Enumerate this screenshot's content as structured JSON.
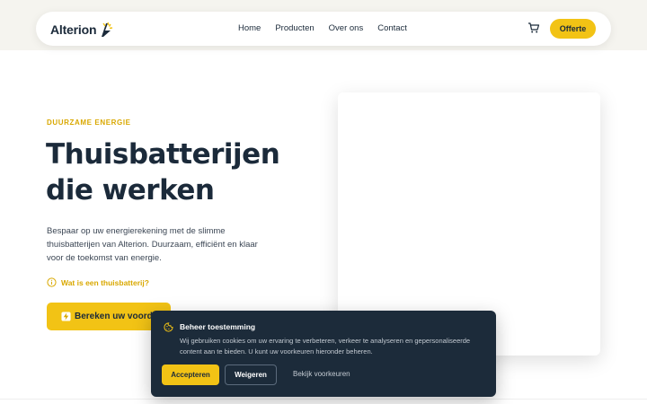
{
  "header": {
    "logo_text": "Alterion",
    "nav": [
      "Home",
      "Producten",
      "Over ons",
      "Contact"
    ],
    "cta_label": "Offerte"
  },
  "hero": {
    "eyebrow": "DUURZAME ENERGIE",
    "title": "Thuisbatterijen die werken",
    "lead": "Bespaar op uw energierekening met de slimme thuisbatterijen van Alterion. Duurzaam, efficiënt en klaar voor de toekomst van energie.",
    "link_label": "Wat is een thuisbatterij?",
    "button_label": "Bereken uw voordeel"
  },
  "cookie": {
    "title": "Beheer toestemming",
    "text": "Wij gebruiken cookies om uw ervaring te verbeteren, verkeer te analyseren en gepersonaliseerde content aan te bieden. U kunt uw voorkeuren hieronder beheren.",
    "accept_label": "Accepteren",
    "refuse_label": "Weigeren",
    "prefs_label": "Bekijk voorkeuren"
  },
  "colors": {
    "accent": "#f2c315",
    "navy": "#1c2b3a",
    "eyebrow": "#d9a800"
  },
  "icons": [
    "cart-icon",
    "info-icon",
    "bolt-icon",
    "cookie-icon",
    "logo-mark-icon"
  ]
}
